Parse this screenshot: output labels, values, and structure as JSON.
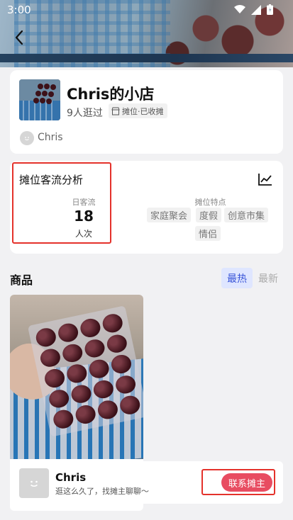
{
  "status_bar": {
    "time": "3:00"
  },
  "shop": {
    "name": "Chris的小店",
    "visits": "9人逛过",
    "tag": "摊位·已收摊",
    "owner": "Chris"
  },
  "stats": {
    "title": "摊位客流分析",
    "daily_label": "日客流",
    "daily_value": "18",
    "daily_unit": "人次",
    "features_label": "摊位特点",
    "features": [
      "家庭聚会",
      "度假",
      "创意市集",
      "情侣"
    ]
  },
  "products": {
    "title": "商品",
    "sort_hot": "最热",
    "sort_new": "最新"
  },
  "contact": {
    "name": "Chris",
    "message": "逛这么久了，找摊主聊聊～",
    "button": "联系摊主"
  },
  "colors": {
    "accent_pink": "#e84c61",
    "highlight_red": "#e4322b",
    "sort_blue": "#3a55d8"
  }
}
